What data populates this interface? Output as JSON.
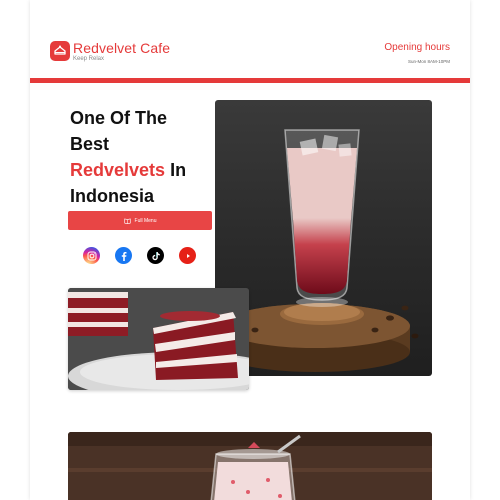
{
  "brand": {
    "name": "Redvelvet Cafe",
    "tagline": "Keep Relax",
    "logo_icon": "cake-slice-icon",
    "accent_color": "#e53a3a"
  },
  "hours": {
    "title": "Opening hours",
    "value": "Sun-Mon 8AM-10PM"
  },
  "hero": {
    "title_line1": "One Of The",
    "title_line2": "Best",
    "title_accent": "Redvelvets",
    "title_after_accent": " In",
    "title_line4": "Indonesia",
    "menu_button_label": "Full Menu",
    "menu_button_icon": "book-icon"
  },
  "socials": [
    {
      "name": "instagram",
      "icon": "instagram-icon"
    },
    {
      "name": "facebook",
      "icon": "facebook-icon"
    },
    {
      "name": "tiktok",
      "icon": "tiktok-icon"
    },
    {
      "name": "youtube",
      "icon": "youtube-icon"
    }
  ],
  "images": {
    "drink": "red velvet iced drink photo",
    "cake": "red velvet cake slice photo",
    "milkshake": "strawberry milk jar photo"
  }
}
